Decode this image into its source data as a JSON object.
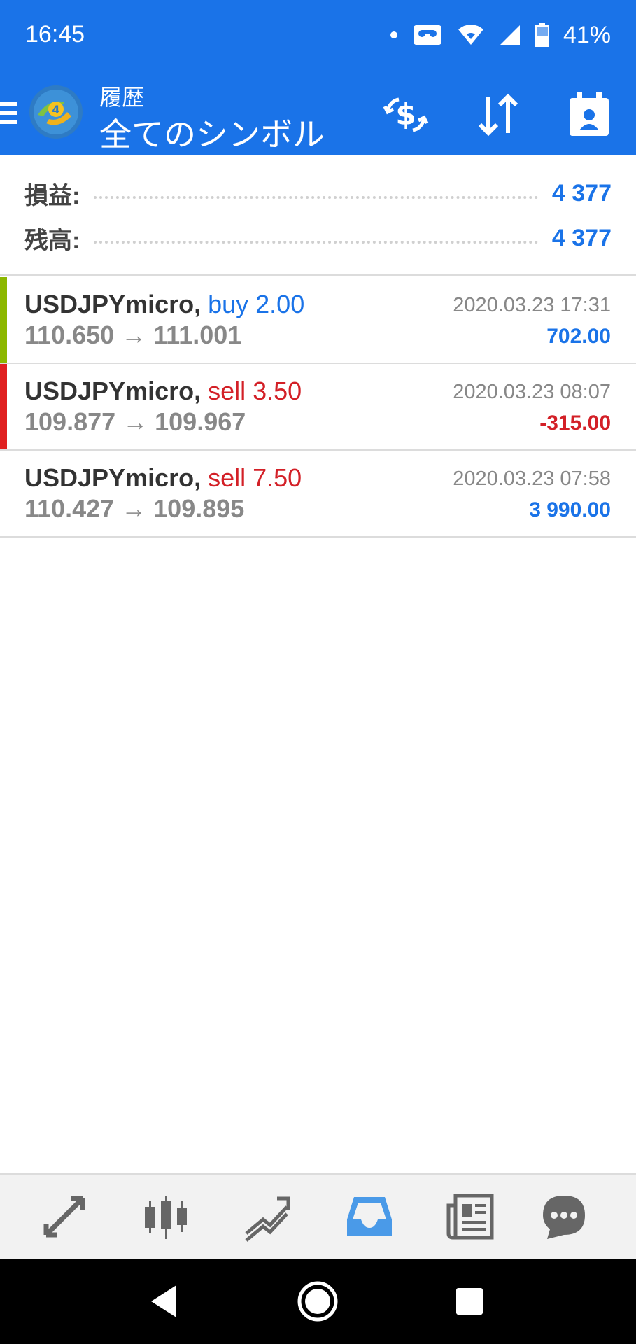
{
  "status_bar": {
    "time": "16:45",
    "battery": "41%",
    "icons": [
      "notification-dot-icon",
      "voicemail-icon",
      "wifi-icon",
      "signal-icon",
      "battery-icon"
    ]
  },
  "app_bar": {
    "title_small": "履歴",
    "title_large": "全てのシンボル",
    "actions": [
      "currency-exchange-icon",
      "sort-icon",
      "account-icon"
    ]
  },
  "summary": {
    "profit_label": "損益:",
    "profit_value": "4 377",
    "balance_label": "残高:",
    "balance_value": "4 377"
  },
  "deals": [
    {
      "symbol": "USDJPYmicro,",
      "side": "buy 2.00",
      "prices": "110.650 → 111.001",
      "time": "2020.03.23 17:31",
      "profit": "702.00",
      "color": "#8cb700"
    },
    {
      "symbol": "USDJPYmicro,",
      "side": "sell 3.50",
      "prices": "109.877 → 109.967",
      "time": "2020.03.23 08:07",
      "profit": "-315.00",
      "color": "#e02020"
    },
    {
      "symbol": "USDJPYmicro,",
      "side": "sell 7.50",
      "prices": "110.427 → 109.895",
      "time": "2020.03.23 07:58",
      "profit": "3 990.00",
      "color": "#ffffff"
    }
  ],
  "bottom_nav": [
    "quotes-icon",
    "chart-icon",
    "trade-icon",
    "history-icon",
    "news-icon",
    "chat-icon"
  ],
  "colors": {
    "accent": "#1a73e8",
    "loss": "#d32027",
    "buy_bar": "#8cb700",
    "sell_bar": "#e02020"
  }
}
